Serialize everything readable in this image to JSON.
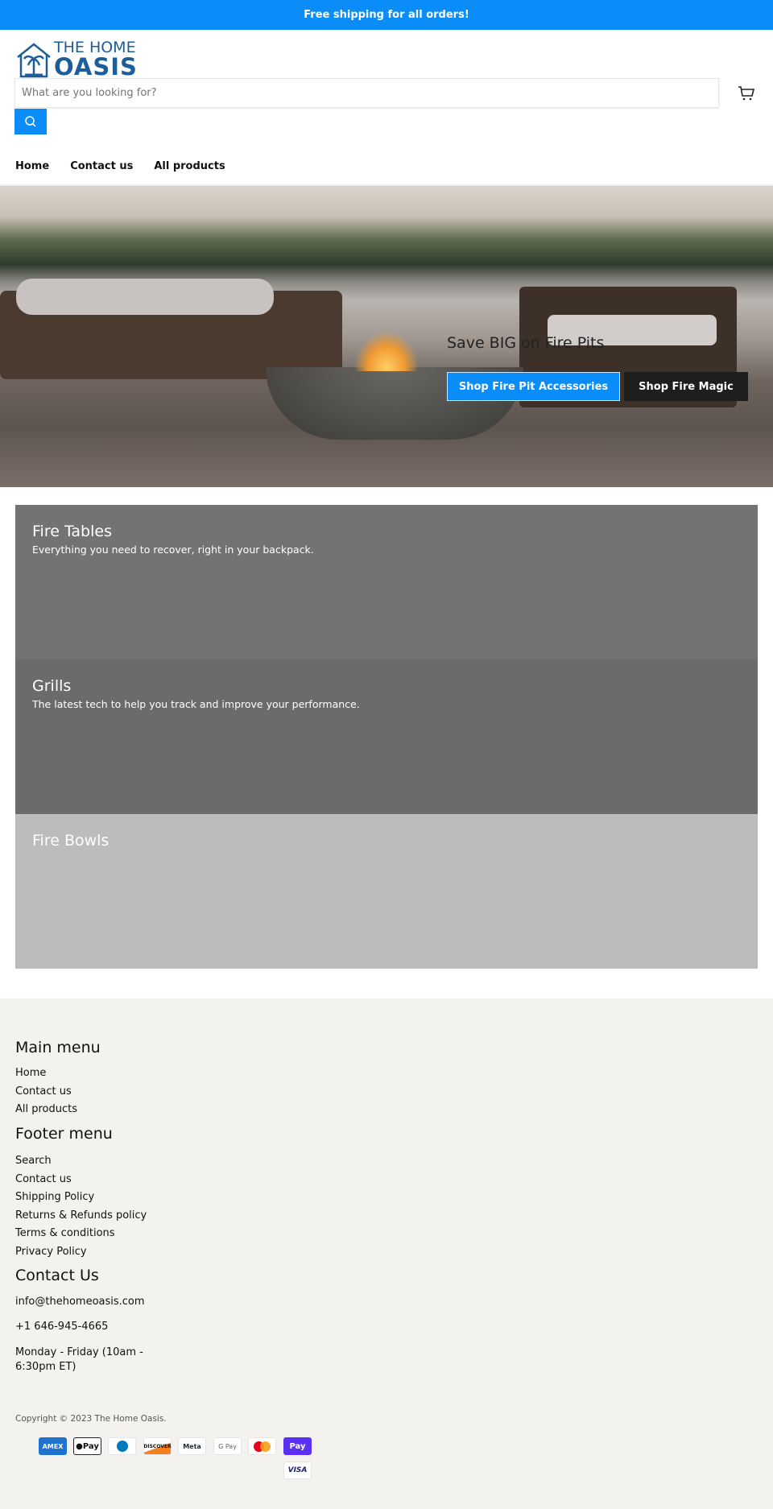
{
  "banner": {
    "text": "Free shipping for all orders!",
    "color": "#0a8cf9"
  },
  "header": {
    "logo_line1": "THE HOME",
    "logo_line2": "OASIS",
    "search_placeholder": "What are you looking for?",
    "search_icon": "search-icon",
    "cart_icon": "cart-icon"
  },
  "nav": {
    "items": [
      {
        "label": "Home"
      },
      {
        "label": "Contact us"
      },
      {
        "label": "All products"
      }
    ]
  },
  "hero": {
    "title": "Save BIG on Fire Pits",
    "buttons": [
      {
        "label": "Shop Fire Pit Accessories"
      },
      {
        "label": "Shop Fire Magic"
      }
    ]
  },
  "collections": [
    {
      "title": "Fire Tables",
      "description": "Everything you need to recover, right in your backpack.",
      "color": "#737373"
    },
    {
      "title": "Grills",
      "description": "The latest tech to help you track and improve your performance.",
      "color": "#6b6b6b"
    },
    {
      "title": "Fire Bowls",
      "description": "",
      "color": "#bcbcbc"
    }
  ],
  "footer": {
    "main_menu": {
      "title": "Main menu",
      "items": [
        "Home",
        "Contact us",
        "All products"
      ]
    },
    "footer_menu": {
      "title": "Footer menu",
      "items": [
        "Search",
        "Contact us",
        "Shipping Policy",
        "Returns & Refunds policy",
        "Terms & conditions",
        "Privacy Policy"
      ]
    },
    "contact": {
      "title": "Contact Us",
      "email": "info@thehomeoasis.com",
      "phone": "+1 646-945-4665",
      "hours": "Monday - Friday (10am - 6:30pm ET)"
    },
    "copyright": "Copyright © 2023 The Home Oasis.",
    "payments": [
      "AMEX",
      "Pay",
      "",
      "DISCOVER",
      "Meta",
      "G Pay",
      "",
      "Pay",
      "VISA"
    ]
  }
}
